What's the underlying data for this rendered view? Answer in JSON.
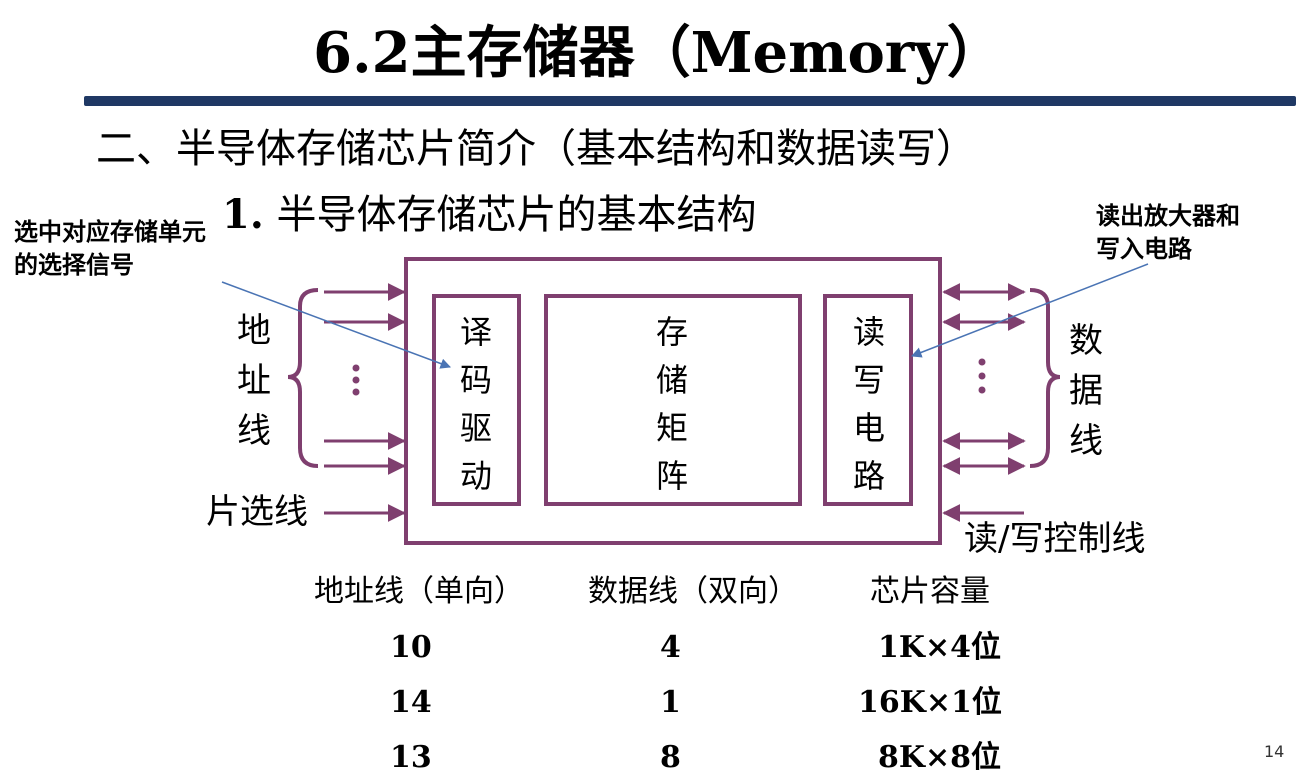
{
  "header": {
    "title": "6.2主存储器（Memory）",
    "section": "二、半导体存储芯片简介（基本结构和数据读写）",
    "subsection_number": "1.",
    "subsection_text": "半导体存储芯片的基本结构"
  },
  "diagram": {
    "annotation_left": "选中对应存储单元的选择信号",
    "annotation_right": "读出放大器和写入电路",
    "address_lines": "地址线",
    "data_lines": "数据线",
    "chip_select": "片选线",
    "rw_control": "读/写控制线",
    "decoder": "译码驱动",
    "matrix": "存储矩阵",
    "rw_circuit": "读写电路",
    "colors": {
      "diagram": "#7f3f6f",
      "pointer": "#4a74b4",
      "rule": "#1f3864"
    }
  },
  "table": {
    "headers": [
      "地址线（单向）",
      "数据线（双向）",
      "芯片容量"
    ],
    "rows": [
      [
        "10",
        "4",
        "1K×4位"
      ],
      [
        "14",
        "1",
        "16K×1位"
      ],
      [
        "13",
        "8",
        "8K×8位"
      ]
    ]
  },
  "page_number": "14"
}
